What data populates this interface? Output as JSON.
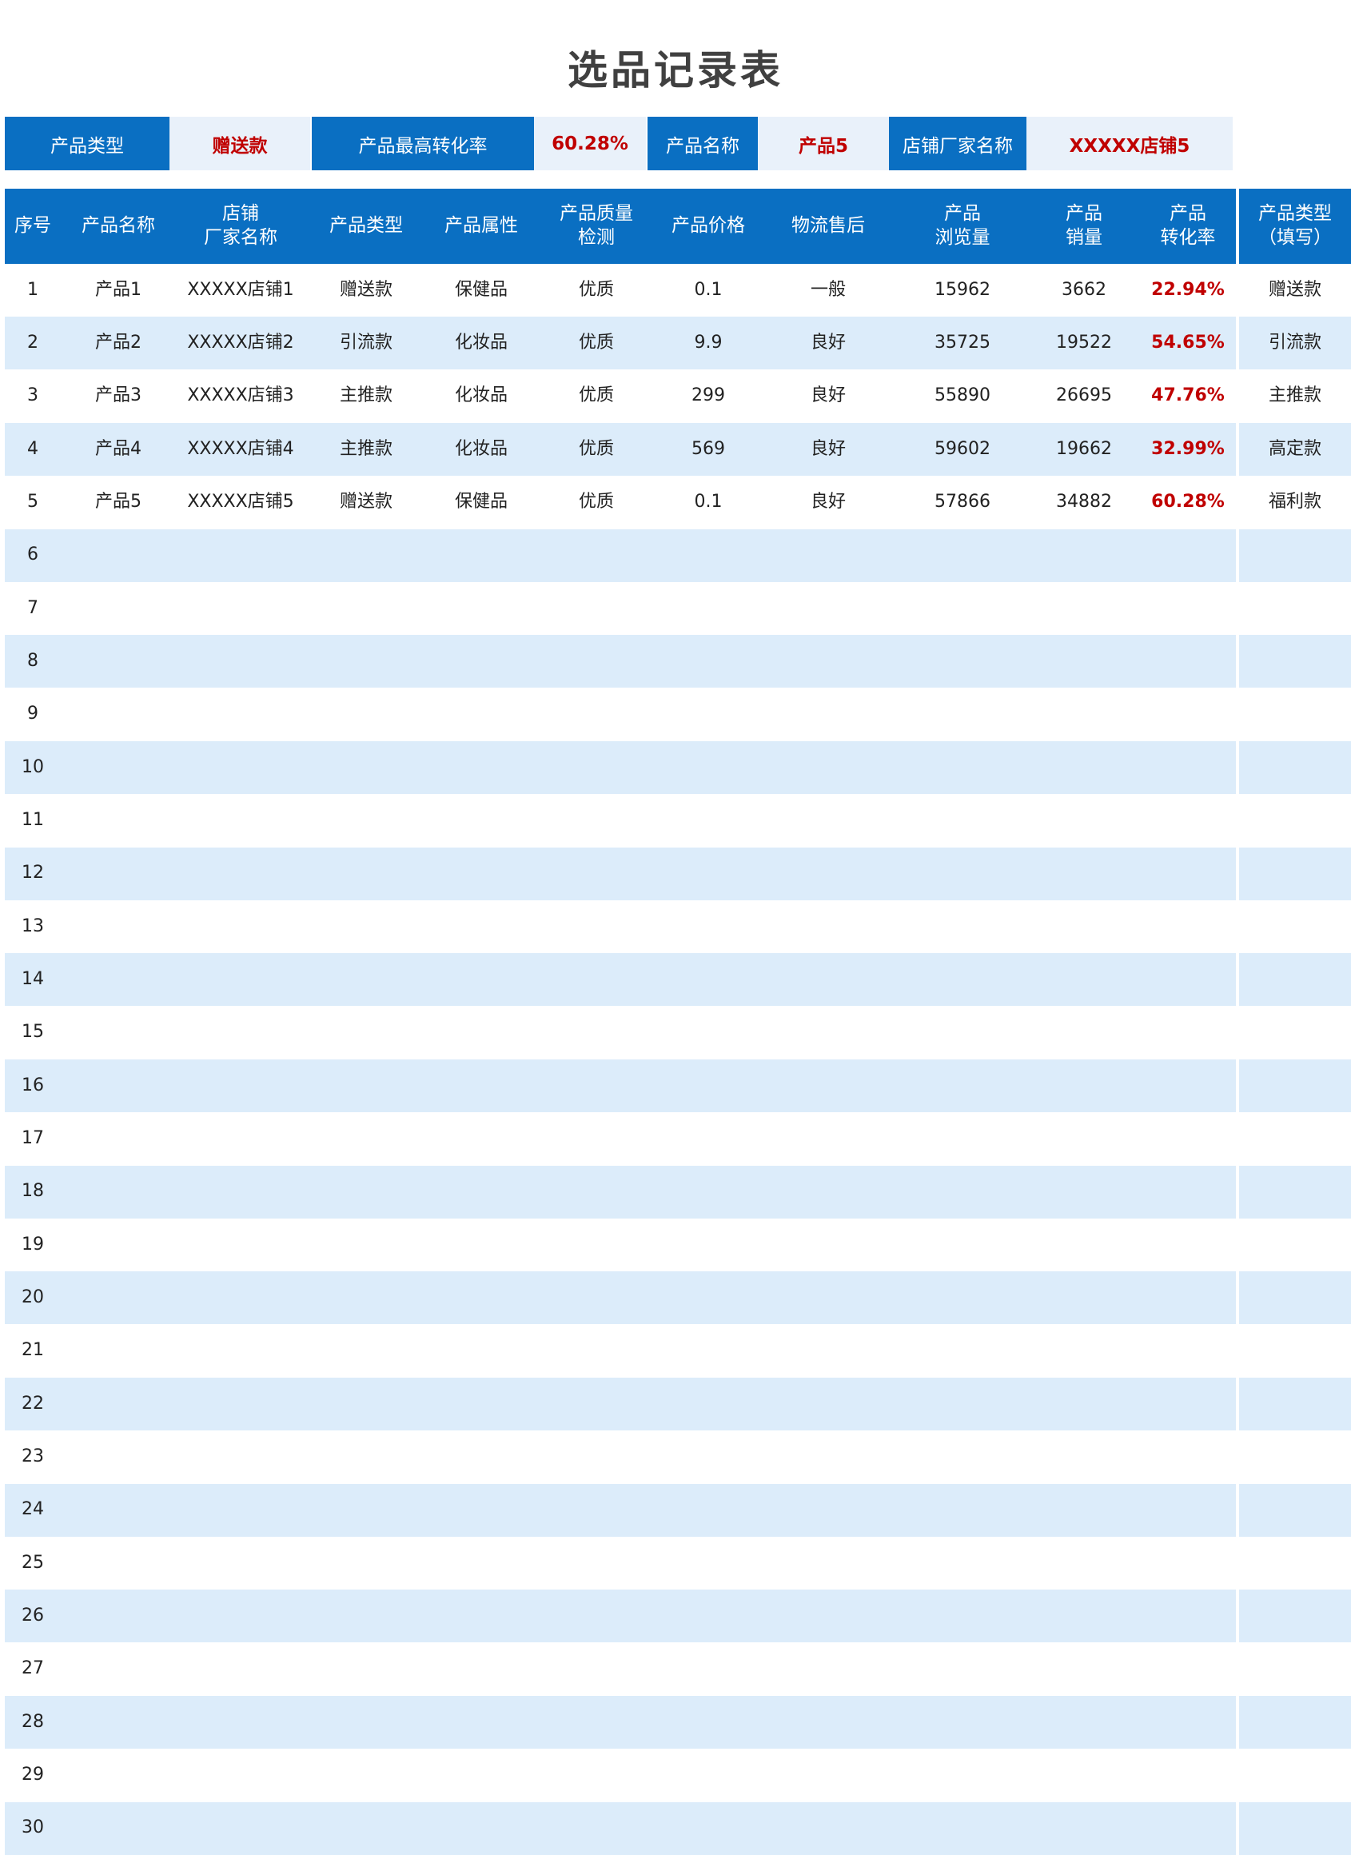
{
  "title": "选品记录表",
  "summary": [
    {
      "label": "产品类型",
      "value": "赠送款"
    },
    {
      "label": "产品最高转化率",
      "value": "60.28%"
    },
    {
      "label": "产品名称",
      "value": "产品5"
    },
    {
      "label": "店铺厂家名称",
      "value": "XXXXX店铺5"
    }
  ],
  "headers": [
    [
      "序号"
    ],
    [
      "产品名称"
    ],
    [
      "店铺",
      "厂家名称"
    ],
    [
      "产品类型"
    ],
    [
      "产品属性"
    ],
    [
      "产品质量",
      "检测"
    ],
    [
      "产品价格"
    ],
    [
      "物流售后"
    ],
    [
      "产品",
      "浏览量"
    ],
    [
      "产品",
      "销量"
    ],
    [
      "产品",
      "转化率"
    ],
    [
      "产品类型",
      "（填写）"
    ]
  ],
  "rows": [
    [
      "1",
      "产品1",
      "XXXXX店铺1",
      "赠送款",
      "保健品",
      "优质",
      "0.1",
      "一般",
      "15962",
      "3662",
      "22.94%",
      "赠送款"
    ],
    [
      "2",
      "产品2",
      "XXXXX店铺2",
      "引流款",
      "化妆品",
      "优质",
      "9.9",
      "良好",
      "35725",
      "19522",
      "54.65%",
      "引流款"
    ],
    [
      "3",
      "产品3",
      "XXXXX店铺3",
      "主推款",
      "化妆品",
      "优质",
      "299",
      "良好",
      "55890",
      "26695",
      "47.76%",
      "主推款"
    ],
    [
      "4",
      "产品4",
      "XXXXX店铺4",
      "主推款",
      "化妆品",
      "优质",
      "569",
      "良好",
      "59602",
      "19662",
      "32.99%",
      "高定款"
    ],
    [
      "5",
      "产品5",
      "XXXXX店铺5",
      "赠送款",
      "保健品",
      "优质",
      "0.1",
      "良好",
      "57866",
      "34882",
      "60.28%",
      "福利款"
    ],
    [
      "6"
    ],
    [
      "7"
    ],
    [
      "8"
    ],
    [
      "9"
    ],
    [
      "10"
    ],
    [
      "11"
    ],
    [
      "12"
    ],
    [
      "13"
    ],
    [
      "14"
    ],
    [
      "15"
    ],
    [
      "16"
    ],
    [
      "17"
    ],
    [
      "18"
    ],
    [
      "19"
    ],
    [
      "20"
    ],
    [
      "21"
    ],
    [
      "22"
    ],
    [
      "23"
    ],
    [
      "24"
    ],
    [
      "25"
    ],
    [
      "26"
    ],
    [
      "27"
    ],
    [
      "28"
    ],
    [
      "29"
    ],
    [
      "30"
    ]
  ],
  "colors": {
    "header_blue": "#0a6fc2",
    "stripe_blue": "#dcecfa",
    "highlight_red": "#c00000"
  }
}
